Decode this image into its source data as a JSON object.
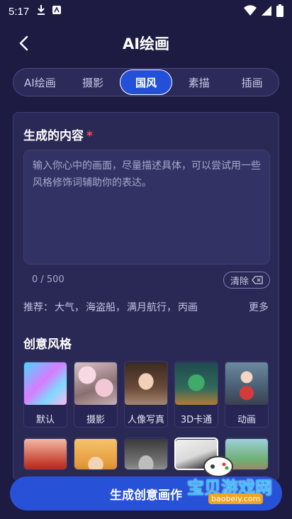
{
  "status_bar": {
    "time": "5:17"
  },
  "header": {
    "title": "AI绘画"
  },
  "tabs": [
    {
      "label": "AI绘画",
      "active": false
    },
    {
      "label": "摄影",
      "active": false
    },
    {
      "label": "国风",
      "active": true
    },
    {
      "label": "素描",
      "active": false
    },
    {
      "label": "插画",
      "active": false
    }
  ],
  "prompt": {
    "title": "生成的内容",
    "required_mark": "*",
    "placeholder": "输入你心中的画面，尽量描述具体，可以尝试用一些风格修饰词辅助你的表达。",
    "counter": "0 / 500",
    "clear_label": "清除"
  },
  "recommend": {
    "prefix": "推荐：",
    "items": [
      "大气，",
      "海盗船，",
      "满月航行，",
      "丙画"
    ],
    "more_label": "更多"
  },
  "styles": {
    "title": "创意风格",
    "row1": [
      "默认",
      "摄影",
      "人像写真",
      "3D卡通",
      "动画"
    ],
    "row2_selected_index": 3
  },
  "footer": {
    "generate_label": "生成创意画作"
  },
  "watermark": {
    "text": "宝贝游戏网",
    "url": "baobeiy.com"
  },
  "colors": {
    "accent": "#2752d8",
    "background": "#1d1b42",
    "required": "#ff4d4f"
  }
}
